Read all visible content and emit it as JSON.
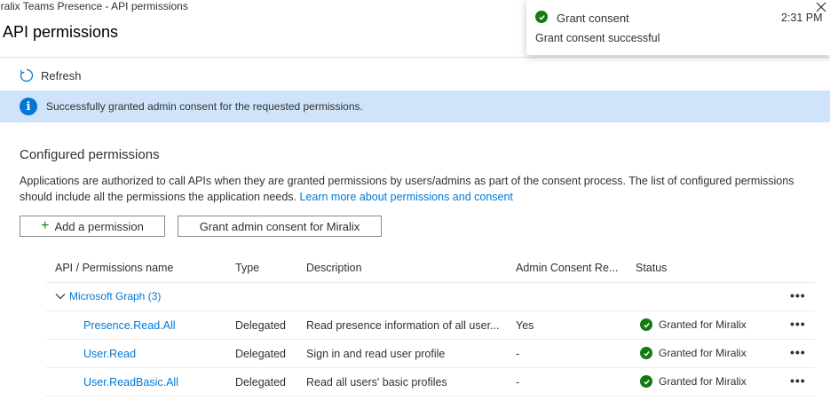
{
  "breadcrumb": "iralix Teams Presence - API permissions",
  "page_title": "API permissions",
  "toolbar": {
    "refresh_label": "Refresh"
  },
  "banner": {
    "text": "Successfully granted admin consent for the requested permissions."
  },
  "section": {
    "title": "Configured permissions",
    "description": "Applications are authorized to call APIs when they are granted permissions by users/admins as part of the consent process. The list of configured permissions should include all the permissions the application needs.",
    "learn_more": "Learn more about permissions and consent"
  },
  "buttons": {
    "add_permission": "Add a permission",
    "grant_consent": "Grant admin consent for Miralix"
  },
  "table": {
    "headers": {
      "name": "API / Permissions name",
      "type": "Type",
      "description": "Description",
      "admin_consent": "Admin Consent Re...",
      "status": "Status"
    },
    "group": {
      "label": "Microsoft Graph (3)"
    },
    "rows": [
      {
        "name": "Presence.Read.All",
        "type": "Delegated",
        "description": "Read presence information of all user...",
        "admin_consent": "Yes",
        "status": "Granted for Miralix"
      },
      {
        "name": "User.Read",
        "type": "Delegated",
        "description": "Sign in and read user profile",
        "admin_consent": "-",
        "status": "Granted for Miralix"
      },
      {
        "name": "User.ReadBasic.All",
        "type": "Delegated",
        "description": "Read all users' basic profiles",
        "admin_consent": "-",
        "status": "Granted for Miralix"
      }
    ],
    "more_label": "•••"
  },
  "toast": {
    "title": "Grant consent",
    "time": "2:31 PM",
    "message": "Grant consent successful"
  },
  "colors": {
    "accent": "#0078d4",
    "success": "#107c10",
    "banner_bg": "#cfe4fa"
  }
}
